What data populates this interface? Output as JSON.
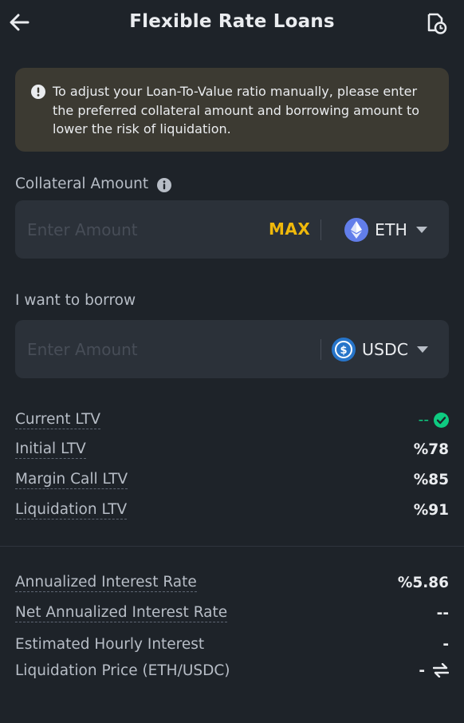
{
  "header": {
    "title": "Flexible Rate Loans",
    "back_icon": "arrow-left-icon",
    "history_icon": "history-icon"
  },
  "notice": {
    "icon": "exclamation-circle-icon",
    "text": "To adjust your Loan-To-Value ratio manually, please enter the preferred collateral amount and borrowing amount to lower the risk of liquidation."
  },
  "collateral": {
    "label": "Collateral Amount",
    "placeholder": "Enter Amount",
    "max_label": "MAX",
    "asset": "ETH"
  },
  "borrow": {
    "label": "I want to borrow",
    "placeholder": "Enter Amount",
    "asset": "USDC"
  },
  "ltv": {
    "current": {
      "label": "Current LTV",
      "value": "--"
    },
    "initial": {
      "label": "Initial LTV",
      "value": "%78"
    },
    "margin_call": {
      "label": "Margin Call LTV",
      "value": "%85"
    },
    "liquidation": {
      "label": "Liquidation LTV",
      "value": "%91"
    }
  },
  "interest": {
    "annualized": {
      "label": "Annualized Interest Rate",
      "value": "%5.86"
    },
    "net_annualized": {
      "label": "Net Annualized Interest Rate",
      "value": "--"
    },
    "hourly": {
      "label": "Estimated Hourly Interest",
      "value": "-"
    },
    "liq_price": {
      "label": "Liquidation Price (ETH/USDC)",
      "value": "-"
    }
  },
  "colors": {
    "accent": "#f0b90b",
    "success": "#0ecb81",
    "background": "#1e2329",
    "panel": "#2b3139",
    "eth": "#627eea",
    "usdc": "#2775ca"
  }
}
